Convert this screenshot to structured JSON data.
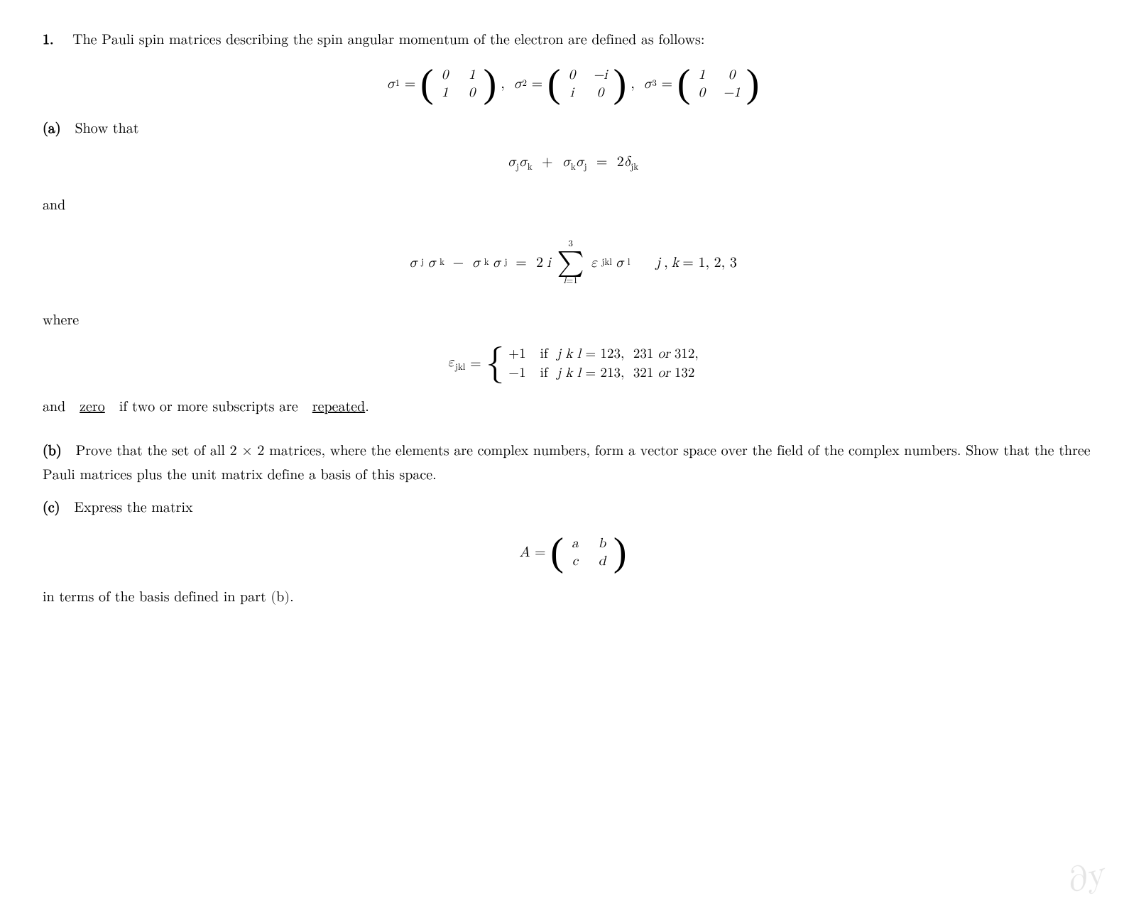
{
  "problem": {
    "number": "1.",
    "intro": "The Pauli spin matrices describing the spin angular momentum of the electron are defined as follows:",
    "part_a_label": "(a)",
    "part_a_text": "Show that",
    "eq1_text": "σ_j σ_k + σ_k σ_j = 2δ_jk",
    "and_text": "and",
    "eq2_text": "σ_j σ_k − σ_k σ_j = 2i Σ ε_jkl σ_l   j, k = 1, 2, 3",
    "where_text": "where",
    "epsilon_def_intro": "ε_jkl =",
    "cases_row1_val": "+1",
    "cases_row1_cond": "if  j k l = 123,  231",
    "cases_row1_or": "or",
    "cases_row1_end": "312,",
    "cases_row2_val": "−1",
    "cases_row2_cond": "if  j k l = 213,  321",
    "cases_row2_or": "or",
    "cases_row2_end": "132",
    "and2_text": "and",
    "zero_text": "zero",
    "and2_rest": "if two or more subscripts are",
    "repeated_text": "repeated",
    "period": ".",
    "part_b_label": "(b)",
    "part_b_text": "Prove that the set of all 2 × 2 matrices, where the elements are complex numbers, form a vector space over the field of the complex numbers. Show that the three Pauli matrices plus the unit matrix define a basis of this space.",
    "part_c_label": "(c)",
    "part_c_text": "Express the matrix",
    "part_c_end": "in terms of the basis defined in part (b).",
    "watermark": "∂y"
  }
}
